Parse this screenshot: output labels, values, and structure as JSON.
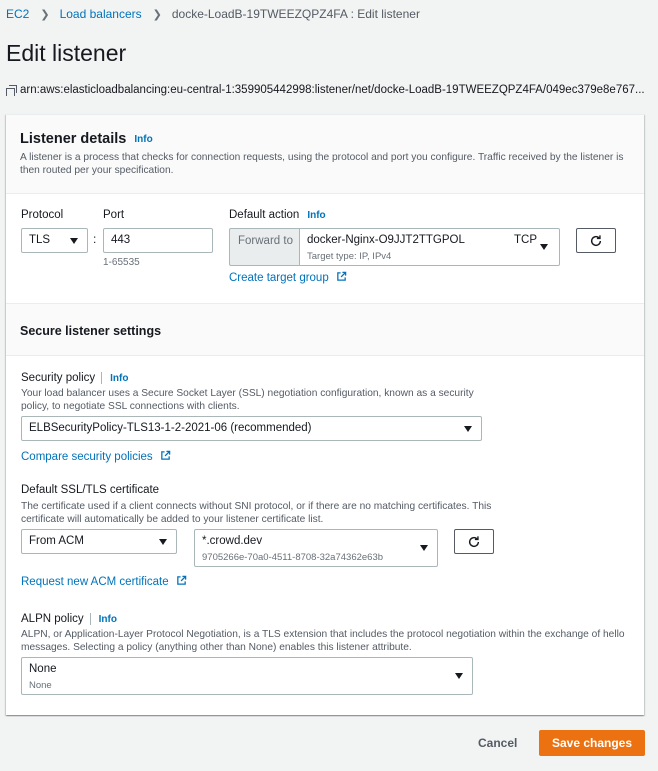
{
  "breadcrumb": [
    "EC2",
    "Load balancers",
    "docke-LoadB-19TWEEZQPZ4FA : Edit listener"
  ],
  "page_title": "Edit listener",
  "arn": "arn:aws:elasticloadbalancing:eu-central-1:359905442998:listener/net/docke-LoadB-19TWEEZQPZ4FA/049ec379e8e767...",
  "listener_details": {
    "title": "Listener details",
    "info": "Info",
    "description": "A listener is a process that checks for connection requests, using the protocol and port you configure. Traffic received by the listener is then routed per your specification.",
    "protocol_label": "Protocol",
    "protocol_value": "TLS",
    "colon": ":",
    "port_label": "Port",
    "port_value": "443",
    "port_hint": "1-65535",
    "default_action_label": "Default action",
    "default_action_info": "Info",
    "forward_to": "Forward to",
    "target_group_name": "docker-Nginx-O9JJT2TTGPOL",
    "target_group_protocol": "TCP",
    "target_group_sub": "Target type: IP, IPv4",
    "create_target_group": "Create target group"
  },
  "secure_settings": {
    "title": "Secure listener settings",
    "security_policy_label": "Security policy",
    "security_policy_info": "Info",
    "security_policy_desc": "Your load balancer uses a Secure Socket Layer (SSL) negotiation configuration, known as a security policy, to negotiate SSL connections with clients.",
    "security_policy_value": "ELBSecurityPolicy-TLS13-1-2-2021-06 (recommended)",
    "compare_policies": "Compare security policies",
    "cert_label": "Default SSL/TLS certificate",
    "cert_desc": "The certificate used if a client connects without SNI protocol, or if there are no matching certificates. This certificate will automatically be added to your listener certificate list.",
    "cert_source": "From ACM",
    "cert_name": "*.crowd.dev",
    "cert_id": "9705266e-70a0-4511-8708-32a74362e63b",
    "request_cert": "Request new ACM certificate",
    "alpn_label": "ALPN policy",
    "alpn_info": "Info",
    "alpn_desc": "ALPN, or Application-Layer Protocol Negotiation, is a TLS extension that includes the protocol negotiation within the exchange of hello messages. Selecting a policy (anything other than None) enables this listener attribute.",
    "alpn_value": "None",
    "alpn_sub": "None"
  },
  "footer": {
    "cancel": "Cancel",
    "save": "Save changes"
  },
  "colors": {
    "link": "#0073bb",
    "primary": "#ec7211",
    "background": "#f2f3f3"
  }
}
